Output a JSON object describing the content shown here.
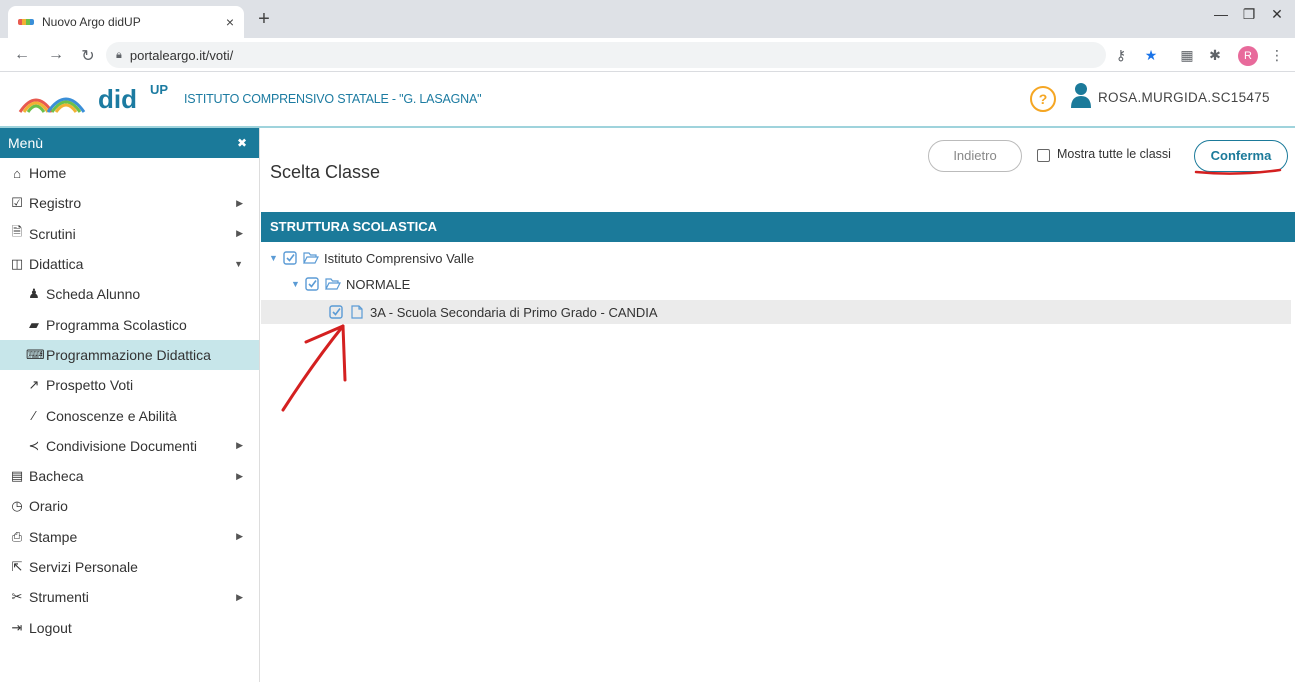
{
  "browser": {
    "tab_title": "Nuovo Argo didUP",
    "tab_close": "×",
    "new_tab": "+",
    "url": "portaleargo.it/voti/",
    "profile_initial": "R"
  },
  "header": {
    "logo_text": "did",
    "logo_sup": "UP",
    "school_name": "ISTITUTO COMPRENSIVO STATALE - \"G. LASAGNA\"",
    "help": "?",
    "username": "ROSA.MURGIDA.SC15475"
  },
  "sidebar": {
    "title": "Menù",
    "close": "✖",
    "items": [
      {
        "label": "Home",
        "icon": "home-icon"
      },
      {
        "label": "Registro",
        "icon": "calendar-check-icon"
      },
      {
        "label": "Scrutini",
        "icon": "document-icon"
      },
      {
        "label": "Didattica",
        "icon": "book-open-icon"
      },
      {
        "label": "Scheda Alunno",
        "icon": "student-icon"
      },
      {
        "label": "Programma Scolastico",
        "icon": "book-icon"
      },
      {
        "label": "Programmazione Didattica",
        "icon": "keyboard-icon"
      },
      {
        "label": "Prospetto Voti",
        "icon": "chart-icon"
      },
      {
        "label": "Conoscenze e Abilità",
        "icon": "magic-wand-icon"
      },
      {
        "label": "Condivisione Documenti",
        "icon": "share-icon"
      },
      {
        "label": "Bacheca",
        "icon": "newspaper-icon"
      },
      {
        "label": "Orario",
        "icon": "clock-icon"
      },
      {
        "label": "Stampe",
        "icon": "printer-icon"
      },
      {
        "label": "Servizi Personale",
        "icon": "external-link-icon"
      },
      {
        "label": "Strumenti",
        "icon": "tools-icon"
      },
      {
        "label": "Logout",
        "icon": "logout-icon"
      }
    ]
  },
  "main": {
    "title": "Scelta Classe",
    "back_label": "Indietro",
    "show_all_label": "Mostra tutte le classi",
    "confirm_label": "Conferma",
    "section_header": "STRUTTURA SCOLASTICA",
    "tree": [
      {
        "label": "Istituto Comprensivo Valle"
      },
      {
        "label": "NORMALE"
      },
      {
        "label": "3A - Scuola Secondaria di Primo Grado - CANDIA"
      }
    ]
  },
  "colors": {
    "primary": "#1b7a9a",
    "active_item": "#c7e6ea",
    "annotation": "#d42020",
    "help": "#f5a623"
  }
}
